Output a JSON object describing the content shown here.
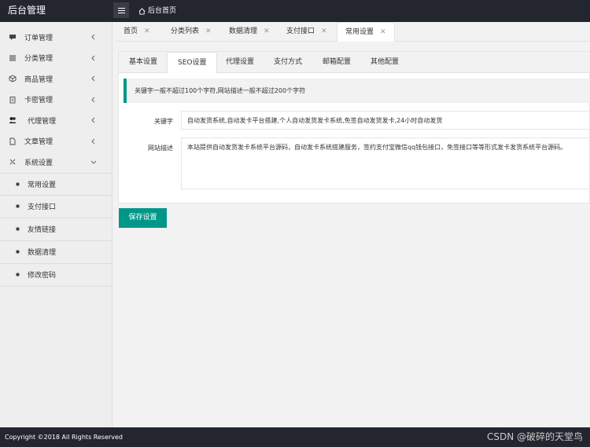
{
  "header": {
    "logo": "后台管理",
    "home_link": "后台首页"
  },
  "sidebar": {
    "items": [
      {
        "label": "订单管理",
        "icon": "chat-icon"
      },
      {
        "label": "分类管理",
        "icon": "list-icon"
      },
      {
        "label": "商品管理",
        "icon": "box-icon"
      },
      {
        "label": "卡密管理",
        "icon": "clipboard-icon"
      },
      {
        "label": "代理管理",
        "icon": "users-icon"
      },
      {
        "label": "文章管理",
        "icon": "document-icon"
      },
      {
        "label": "系统设置",
        "icon": "settings-icon"
      }
    ],
    "sub_items": [
      {
        "label": "常用设置"
      },
      {
        "label": "支付接口"
      },
      {
        "label": "友情链接"
      },
      {
        "label": "数据清理"
      },
      {
        "label": "修改密码"
      }
    ]
  },
  "tabs": [
    {
      "label": "首页",
      "close": "✕"
    },
    {
      "label": "分类列表",
      "close": "✕"
    },
    {
      "label": "数据清理",
      "close": "✕"
    },
    {
      "label": "支付接口",
      "close": "✕"
    },
    {
      "label": "常用设置",
      "close": "✕"
    }
  ],
  "settings": {
    "subtabs": [
      "基本设置",
      "SEO设置",
      "代理设置",
      "支付方式",
      "邮箱配置",
      "其他配置"
    ],
    "notice": "关键字一般不超过100个字符,网站描述一般不超过200个字符",
    "keywords_label": "关键字",
    "keywords_value": "自动发货系统,自动发卡平台搭建,个人自动发货发卡系统,免签自动发货发卡,24小时自动发货",
    "description_label": "网站描述",
    "description_value": "本站提供自动发货发卡系统平台源码，自动发卡系统搭建服务，签约支付宝微信qq钱包接口，免签接口等等形式发卡发货系统平台源码。",
    "save_label": "保存设置"
  },
  "footer": {
    "copyright": "Copyright ©2018 All Rights Reserved",
    "watermark": "CSDN @破碎的天堂鸟"
  }
}
